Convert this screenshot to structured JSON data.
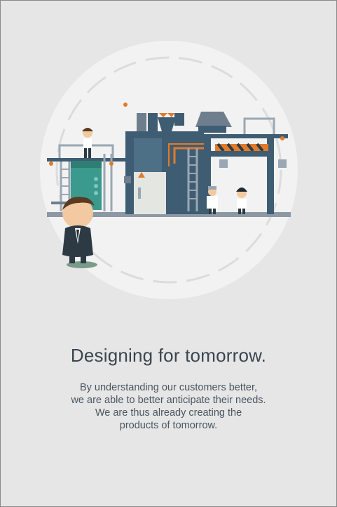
{
  "onboarding": {
    "title": "Designing for tomorrow.",
    "body_lines": [
      "By understanding our customers better,",
      "we are able to better anticipate their needs.",
      "We are thus already creating the",
      "products of tomorrow."
    ]
  },
  "colors": {
    "background": "#e6e6e6",
    "circle": "#f2f2f2",
    "machine_dark": "#3f5d72",
    "accent_orange": "#e07b2a",
    "teal": "#3a9a8e",
    "text_title": "#3a4650"
  },
  "icons": [
    "factory-illustration",
    "businessman-character",
    "worker-character",
    "scientist-character"
  ]
}
